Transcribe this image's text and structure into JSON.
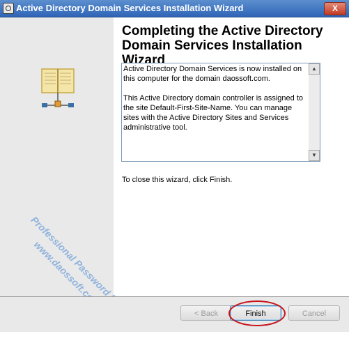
{
  "window": {
    "title": "Active Directory Domain Services Installation Wizard",
    "close_glyph": "X"
  },
  "heading": "Completing the Active Directory Domain Services Installation Wizard",
  "info": {
    "para1": "Active Directory Domain Services is now installed on this computer for the domain daossoft.com.",
    "para2": "This Active Directory domain controller is assigned to the site Default-First-Site-Name. You can manage sites with the Active Directory Sites and Services administrative tool."
  },
  "close_instruction": "To close this wizard, click Finish.",
  "buttons": {
    "back": "< Back",
    "finish": "Finish",
    "cancel": "Cancel"
  },
  "watermark": {
    "line1": "Professional Password Recovery",
    "line2": "www.daossoft.com"
  },
  "scroll": {
    "up": "▲",
    "down": "▼"
  },
  "icons": {
    "app": "app-icon",
    "book": "book-icon"
  }
}
